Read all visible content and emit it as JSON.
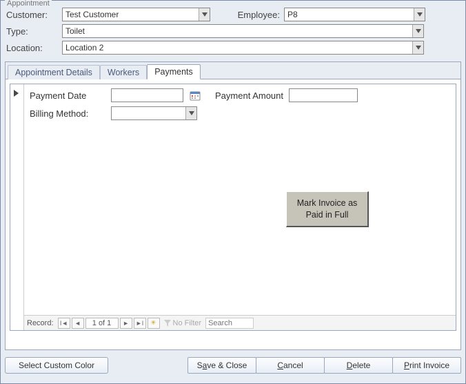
{
  "window": {
    "title": "Appointment"
  },
  "header": {
    "customer_label": "Customer:",
    "customer_value": "Test Customer",
    "employee_label": "Employee:",
    "employee_value": "P8",
    "type_label": "Type:",
    "type_value": "Toilet",
    "location_label": "Location:",
    "location_value": "Location 2"
  },
  "tabs": {
    "details": "Appointment Details",
    "workers": "Workers",
    "payments": "Payments"
  },
  "payments": {
    "payment_date_label": "Payment Date",
    "payment_date_value": "",
    "payment_amount_label": "Payment Amount",
    "payment_amount_value": "",
    "billing_method_label": "Billing Method:",
    "billing_method_value": "",
    "mark_paid_btn": "Mark Invoice as Paid in Full"
  },
  "record_nav": {
    "label": "Record:",
    "counter": "1 of 1",
    "no_filter": "No Filter",
    "search_placeholder": "Search"
  },
  "buttons": {
    "select_color": "Select Custom Color",
    "save_close_pre": "S",
    "save_close_ul": "a",
    "save_close_post": "ve & Close",
    "cancel_ul": "C",
    "cancel_post": "ancel",
    "delete_ul": "D",
    "delete_post": "elete",
    "print_ul": "P",
    "print_post": "rint Invoice"
  }
}
